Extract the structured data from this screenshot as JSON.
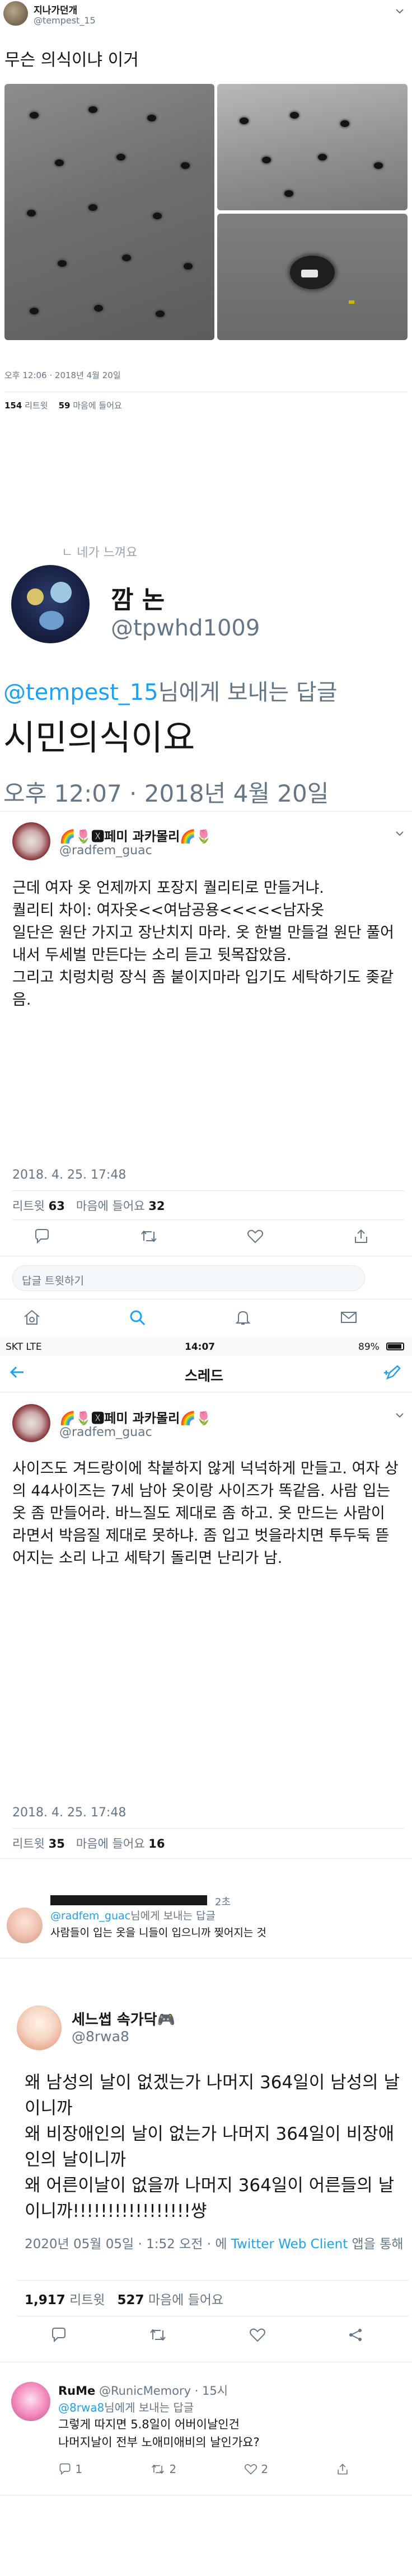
{
  "shot1": {
    "display_name": "지나가던개",
    "handle": "@tempest_15",
    "text": "무슨 의식이냐 이거",
    "meta": "오후 12:06 · 2018년 4월 20일",
    "retweets": "154",
    "retweets_label": "리트윗",
    "likes": "59",
    "likes_label": "마음에 들어요"
  },
  "shot2": {
    "top_cut": "ㄴ 네가 느껴요",
    "display_name": "깜 논",
    "handle": "@tpwhd1009",
    "reply_to": "@tempest_15",
    "reply_suffix": "님에게 보내는 답글",
    "text": "시민의식이요",
    "meta": "오후 12:07 · 2018년 4월 20일"
  },
  "shot3": {
    "display_name": "🌈🌷🆇페미 과카몰리🌈🌷",
    "handle": "@radfem_guac",
    "body": [
      "근데 여자 옷 언제까지 포장지 퀄리티로 만들거냐.",
      "퀄리티 차이: 여자옷<<여남공용<<<<<남자옷",
      "일단은 원단 가지고 장난치지 마라. 옷 한벌 만들걸 원단 풀어내서 두세벌 만든다는 소리 듣고 뒷목잡았음.",
      "그리고 치렁치렁 장식 좀 붙이지마라 입기도 세탁하기도 좆같음."
    ],
    "date": "2018. 4. 25. 17:48",
    "retweets": "63",
    "retweets_label": "리트윗",
    "likes": "32",
    "likes_label": "마음에 들어요",
    "reply_placeholder": "답글 트윗하기"
  },
  "statusbar": {
    "carrier": "SKT  LTE",
    "time": "14:07",
    "battery": "89%"
  },
  "thread": {
    "title": "스레드"
  },
  "shot4": {
    "display_name": "🌈🌷🆇페미 과카몰리🌈🌷",
    "handle": "@radfem_guac",
    "body": "사이즈도 겨드랑이에 착붙하지 않게 넉넉하게 만들고. 여자 상의 44사이즈는 7세 남아 옷이랑 사이즈가 똑같음. 사람 입는 옷 좀 만들어라. 바느질도 제대로 좀 하고. 옷 만드는 사람이라면서 박음질 제대로 못하냐. 좀 입고 벗을라치면 투두둑 뜯어지는 소리 나고 세탁기 돌리면 난리가 남.",
    "date": "2018. 4. 25. 17:48",
    "retweets": "35",
    "retweets_label": "리트윗",
    "likes": "16",
    "likes_label": "마음에 들어요"
  },
  "reply5": {
    "time": "2초",
    "reply_to": "@radfem_guac",
    "reply_suffix": "님에게 보내는 답글",
    "text": "사람들이 입는 옷을 니들이 입으니까 찢어지는 것"
  },
  "shot6": {
    "display_name": "세느썹 속가닥🎮",
    "handle": "@8rwa8",
    "body": "왜 남성의 날이 없겠는가 나머지 364일이 남성의 날이니까\n왜 비장애인의 날이 없는가 나머지 364일이 비장애인의 날이니까\n왜 어른이날이 없을까 나머지 364일이 어른들의 날이니까!!!!!!!!!!!!!!!!!썅",
    "meta": "2020년 05월 05일 · 1:52 오전 · 에",
    "client": "Twitter Web Client",
    "client_suffix": "앱을 통해",
    "retweets": "1,917",
    "retweets_label": "리트윗",
    "likes": "527",
    "likes_label": "마음에 들어요"
  },
  "reply7": {
    "display_name": "RuMe",
    "handle": "@RunicMemory",
    "time": "· 15시",
    "reply_to": "@8rwa8",
    "reply_suffix": "님에게 보내는 답글",
    "text": "그렇게 따지면 5.8일이 어버이날인건\n나머지날이 전부 노애미애비의 날인가요?",
    "replies": "1",
    "retweets": "2",
    "likes": "2"
  },
  "colors": {
    "accent": "#1da1f2",
    "muted": "#657786",
    "separator": "#e1e8ed"
  }
}
